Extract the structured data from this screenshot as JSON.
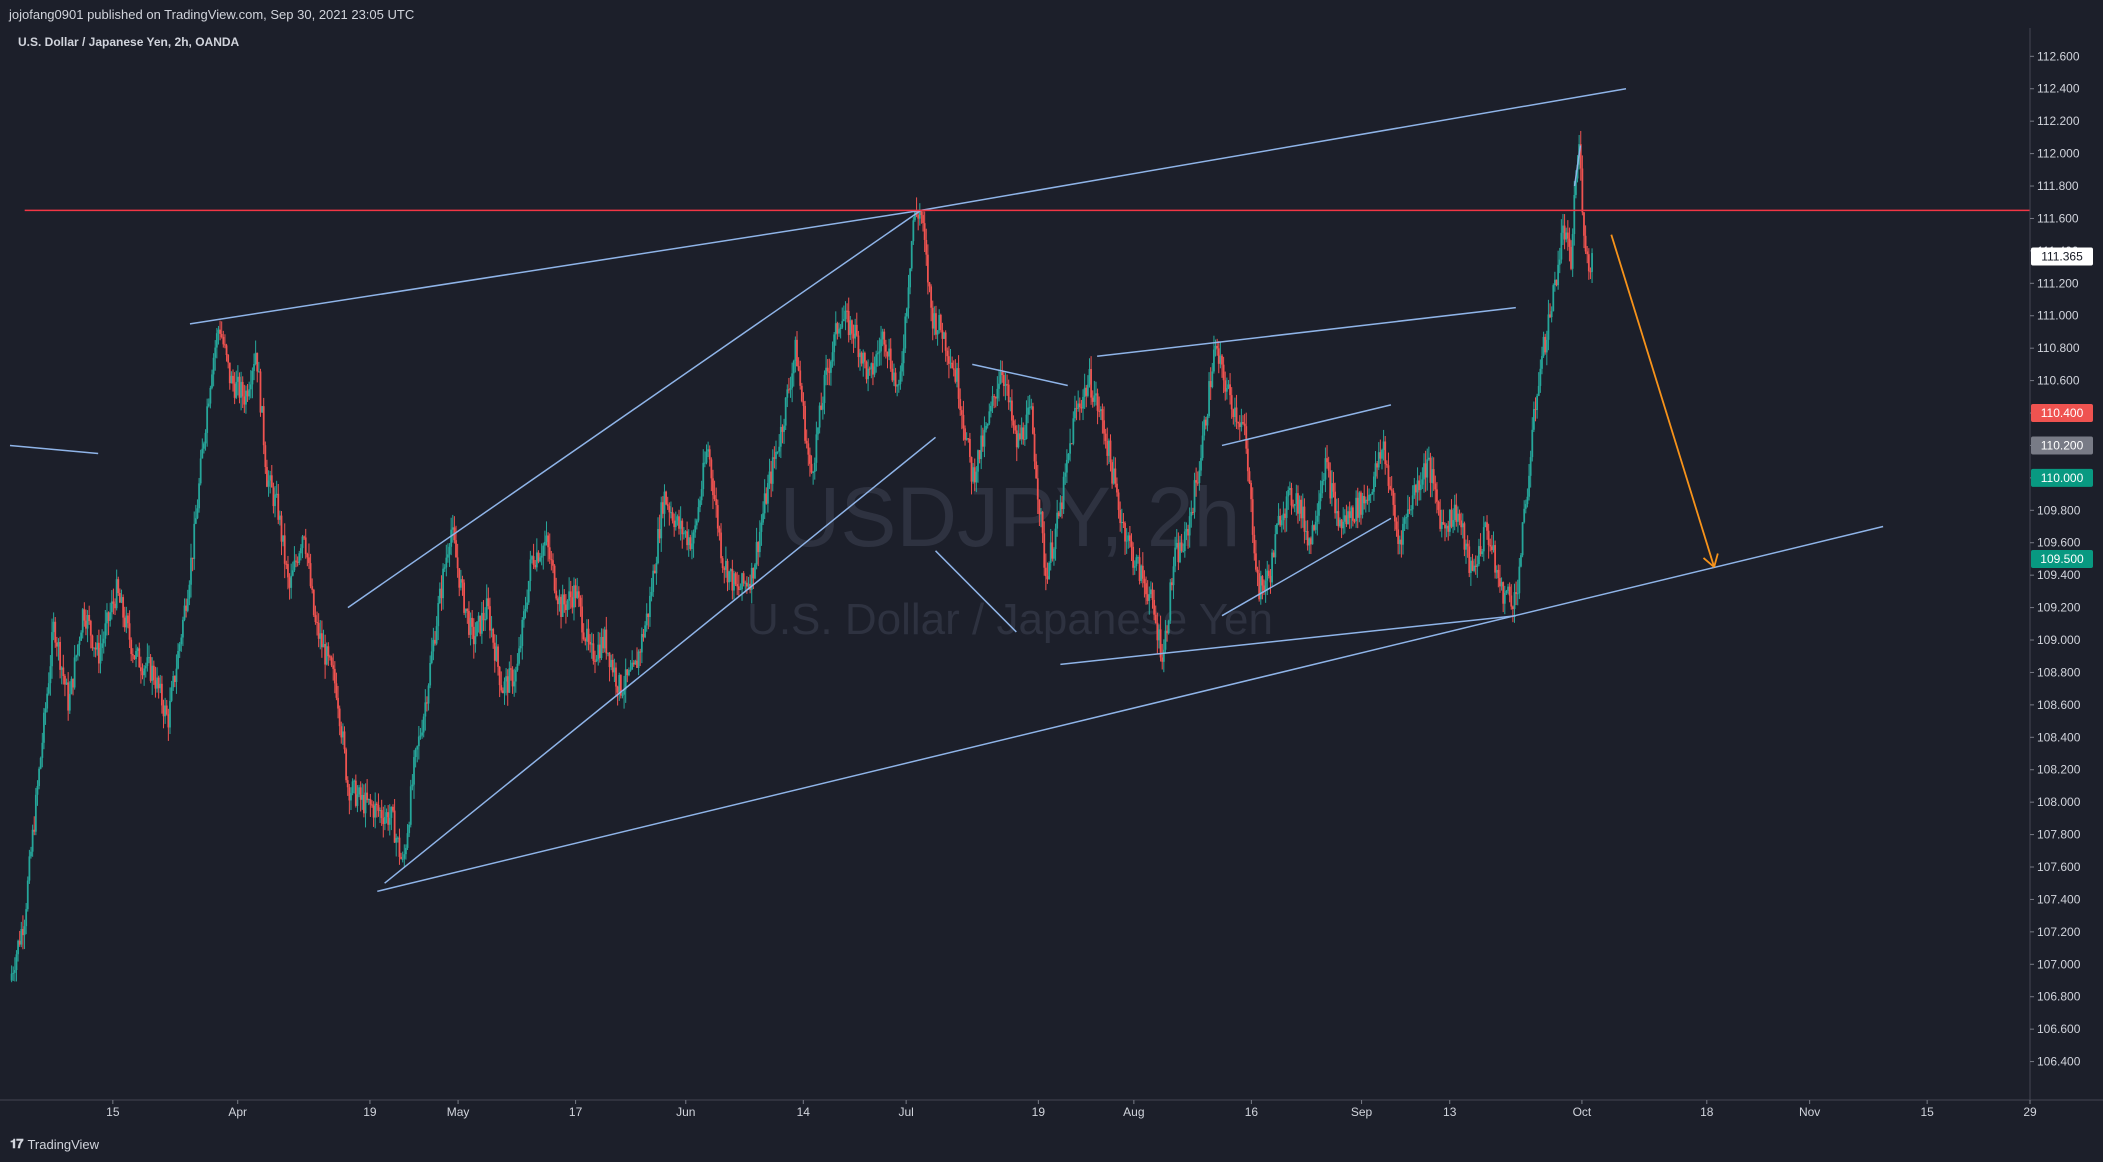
{
  "header": {
    "published": "jojofang0901 published on TradingView.com, Sep 30, 2021 23:05 UTC"
  },
  "footer": {
    "brand": "TradingView"
  },
  "chart_data": {
    "type": "candlestick",
    "symbol_line": "U.S. Dollar / Japanese Yen, 2h, OANDA",
    "watermark_symbol": "USDJPY, 2h",
    "watermark_name": "U.S. Dollar / Japanese Yen",
    "ylim": [
      106.2,
      112.75
    ],
    "y_ticks": [
      "112.600",
      "112.400",
      "112.200",
      "112.000",
      "111.800",
      "111.600",
      "111.400",
      "111.200",
      "111.000",
      "110.800",
      "110.600",
      "110.400",
      "110.200",
      "110.000",
      "109.800",
      "109.600",
      "109.400",
      "109.200",
      "109.000",
      "108.800",
      "108.600",
      "108.400",
      "108.200",
      "108.000",
      "107.800",
      "107.600",
      "107.400",
      "107.200",
      "107.000",
      "106.800",
      "106.600",
      "106.400"
    ],
    "x_ticks": [
      "15",
      "Apr",
      "19",
      "May",
      "17",
      "Jun",
      "14",
      "Jul",
      "19",
      "Aug",
      "16",
      "Sep",
      "13",
      "Oct",
      "18",
      "Nov",
      "15",
      "29"
    ],
    "x_tick_days": [
      14,
      31,
      49,
      61,
      77,
      92,
      108,
      122,
      140,
      153,
      169,
      184,
      196,
      214,
      231,
      245,
      261,
      275
    ],
    "x_range_days": [
      0,
      275
    ],
    "price_labels": [
      {
        "value": 111.365,
        "text": "111.365",
        "bg": "#ffffff",
        "fg": "#131722"
      },
      {
        "value": 110.4,
        "text": "110.400",
        "bg": "#ef5350",
        "fg": "#ffffff"
      },
      {
        "value": 110.2,
        "text": "110.200",
        "bg": "#787b86",
        "fg": "#ffffff"
      },
      {
        "value": 110.0,
        "text": "110.000",
        "bg": "#089981",
        "fg": "#ffffff"
      },
      {
        "value": 109.5,
        "text": "109.500",
        "bg": "#089981",
        "fg": "#ffffff"
      }
    ],
    "price_path": [
      [
        0.0,
        106.9
      ],
      [
        2.0,
        107.3
      ],
      [
        4.0,
        108.2
      ],
      [
        6.0,
        109.1
      ],
      [
        8.0,
        108.6
      ],
      [
        10.0,
        109.2
      ],
      [
        12.0,
        108.9
      ],
      [
        14.5,
        109.3
      ],
      [
        17.0,
        108.9
      ],
      [
        19.5,
        108.8
      ],
      [
        21.5,
        108.5
      ],
      [
        23.5,
        109.1
      ],
      [
        25.0,
        109.6
      ],
      [
        26.5,
        110.3
      ],
      [
        27.5,
        110.7
      ],
      [
        28.5,
        110.95
      ],
      [
        30.0,
        110.6
      ],
      [
        32.0,
        110.5
      ],
      [
        33.5,
        110.8
      ],
      [
        35.0,
        110.0
      ],
      [
        36.5,
        109.8
      ],
      [
        38.0,
        109.3
      ],
      [
        40.0,
        109.7
      ],
      [
        41.5,
        109.1
      ],
      [
        43.0,
        108.9
      ],
      [
        44.5,
        108.7
      ],
      [
        46.0,
        108.1
      ],
      [
        48.0,
        108.0
      ],
      [
        50.0,
        107.95
      ],
      [
        52.0,
        107.9
      ],
      [
        53.5,
        107.6
      ],
      [
        55.0,
        108.2
      ],
      [
        56.5,
        108.6
      ],
      [
        58.0,
        109.1
      ],
      [
        60.0,
        109.7
      ],
      [
        61.5,
        109.3
      ],
      [
        63.0,
        109.0
      ],
      [
        65.0,
        109.2
      ],
      [
        67.0,
        108.7
      ],
      [
        69.0,
        108.8
      ],
      [
        71.0,
        109.5
      ],
      [
        73.0,
        109.6
      ],
      [
        75.0,
        109.2
      ],
      [
        77.0,
        109.3
      ],
      [
        79.0,
        108.9
      ],
      [
        81.0,
        109.0
      ],
      [
        83.0,
        108.7
      ],
      [
        85.0,
        108.8
      ],
      [
        87.0,
        109.2
      ],
      [
        89.0,
        109.9
      ],
      [
        91.0,
        109.7
      ],
      [
        93.0,
        109.6
      ],
      [
        95.0,
        110.2
      ],
      [
        97.0,
        109.5
      ],
      [
        99.0,
        109.3
      ],
      [
        101.0,
        109.4
      ],
      [
        103.0,
        109.9
      ],
      [
        105.0,
        110.3
      ],
      [
        107.0,
        110.8
      ],
      [
        109.0,
        110.0
      ],
      [
        111.0,
        110.6
      ],
      [
        113.0,
        111.0
      ],
      [
        115.0,
        110.9
      ],
      [
        117.0,
        110.6
      ],
      [
        119.0,
        110.9
      ],
      [
        121.0,
        110.5
      ],
      [
        123.0,
        111.6
      ],
      [
        124.0,
        111.65
      ],
      [
        125.5,
        111.0
      ],
      [
        127.0,
        110.9
      ],
      [
        129.0,
        110.6
      ],
      [
        131.0,
        110.0
      ],
      [
        133.0,
        110.3
      ],
      [
        135.0,
        110.7
      ],
      [
        137.0,
        110.2
      ],
      [
        139.0,
        110.4
      ],
      [
        141.0,
        109.4
      ],
      [
        143.0,
        109.8
      ],
      [
        145.0,
        110.4
      ],
      [
        147.0,
        110.6
      ],
      [
        149.0,
        110.3
      ],
      [
        151.0,
        109.8
      ],
      [
        153.0,
        109.5
      ],
      [
        155.0,
        109.3
      ],
      [
        157.0,
        108.9
      ],
      [
        158.5,
        109.5
      ],
      [
        160.0,
        109.6
      ],
      [
        162.0,
        110.1
      ],
      [
        164.0,
        110.8
      ],
      [
        166.0,
        110.5
      ],
      [
        168.0,
        110.3
      ],
      [
        170.0,
        109.3
      ],
      [
        171.5,
        109.4
      ],
      [
        173.0,
        109.8
      ],
      [
        175.0,
        109.9
      ],
      [
        177.0,
        109.6
      ],
      [
        179.0,
        110.1
      ],
      [
        181.0,
        109.7
      ],
      [
        183.0,
        109.8
      ],
      [
        185.0,
        109.9
      ],
      [
        187.0,
        110.2
      ],
      [
        189.0,
        109.6
      ],
      [
        191.0,
        109.9
      ],
      [
        193.0,
        110.1
      ],
      [
        195.0,
        109.7
      ],
      [
        197.0,
        109.8
      ],
      [
        199.0,
        109.4
      ],
      [
        201.0,
        109.7
      ],
      [
        203.0,
        109.3
      ],
      [
        205.0,
        109.25
      ],
      [
        206.5,
        109.9
      ],
      [
        208.0,
        110.6
      ],
      [
        210.0,
        111.1
      ],
      [
        211.5,
        111.55
      ],
      [
        212.5,
        111.3
      ],
      [
        213.0,
        111.75
      ],
      [
        213.6,
        112.05
      ],
      [
        214.2,
        111.6
      ],
      [
        214.8,
        111.3
      ],
      [
        215.4,
        111.365
      ]
    ],
    "trend_lines": [
      {
        "x1": 0.0,
        "y1": 110.2,
        "x2": 12.0,
        "y2": 110.15,
        "color": "#8fb4e8"
      },
      {
        "x1": 24.5,
        "y1": 110.95,
        "x2": 124.0,
        "y2": 111.65,
        "color": "#8fb4e8"
      },
      {
        "x1": 124.0,
        "y1": 111.65,
        "x2": 220.0,
        "y2": 112.4,
        "color": "#8fb4e8"
      },
      {
        "x1": 46.0,
        "y1": 109.2,
        "x2": 124.0,
        "y2": 111.65,
        "color": "#8fb4e8"
      },
      {
        "x1": 51.0,
        "y1": 107.5,
        "x2": 126.0,
        "y2": 110.25,
        "color": "#8fb4e8"
      },
      {
        "x1": 50.0,
        "y1": 107.45,
        "x2": 255.0,
        "y2": 109.7,
        "color": "#8fb4e8"
      },
      {
        "x1": 126.0,
        "y1": 109.55,
        "x2": 137.0,
        "y2": 109.05,
        "color": "#8fb4e8"
      },
      {
        "x1": 131.0,
        "y1": 110.7,
        "x2": 144.0,
        "y2": 110.57,
        "color": "#8fb4e8"
      },
      {
        "x1": 148.0,
        "y1": 110.75,
        "x2": 205.0,
        "y2": 111.05,
        "color": "#8fb4e8"
      },
      {
        "x1": 143.0,
        "y1": 108.85,
        "x2": 205.0,
        "y2": 109.15,
        "color": "#8fb4e8"
      },
      {
        "x1": 165.0,
        "y1": 110.2,
        "x2": 188.0,
        "y2": 110.45,
        "color": "#8fb4e8"
      },
      {
        "x1": 165.0,
        "y1": 109.15,
        "x2": 188.0,
        "y2": 109.75,
        "color": "#8fb4e8"
      },
      {
        "x1": 213.0,
        "y1": 111.8,
        "x2": 213.8,
        "y2": 112.05,
        "color": "#8fb4e8"
      },
      {
        "x1": 2.0,
        "y1": 111.65,
        "x2": 275.0,
        "y2": 111.65,
        "color": "#f23645"
      }
    ],
    "arrow": {
      "x1": 218.0,
      "y1": 111.5,
      "x2": 232.0,
      "y2": 109.45,
      "color": "#f7931a"
    }
  }
}
